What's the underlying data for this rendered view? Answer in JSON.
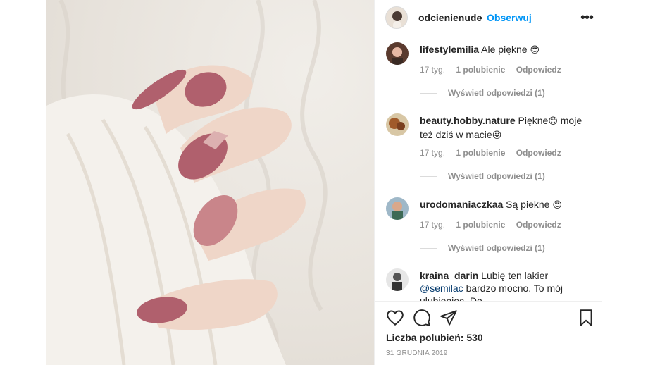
{
  "header": {
    "username": "odcienienude",
    "dot": "•",
    "follow_label": "Obserwuj"
  },
  "comments": [
    {
      "username": "lifestylemilia",
      "text": "Ale piękne",
      "emoji": "😍",
      "text2": "",
      "time": "17 tyg.",
      "likes": "1 polubienie",
      "reply": "Odpowiedz",
      "view_replies": "Wyświetl odpowiedzi (1)"
    },
    {
      "username": "beauty.hobby.nature",
      "text": "Piękne",
      "emoji": "😊",
      "text2": "moje też dziś w macie",
      "emoji2": "😛",
      "time": "17 tyg.",
      "likes": "1 polubienie",
      "reply": "Odpowiedz",
      "view_replies": "Wyświetl odpowiedzi (1)"
    },
    {
      "username": "urodomaniaczkaa",
      "text": "Są piekne",
      "emoji": "😍",
      "text2": "",
      "time": "17 tyg.",
      "likes": "1 polubienie",
      "reply": "Odpowiedz",
      "view_replies": "Wyświetl odpowiedzi (1)"
    },
    {
      "username": "kraina_darin",
      "text": "Lubię ten lakier",
      "mention": "@semilac",
      "text2": "bardzo mocno. To mój ulubieniec. Do"
    }
  ],
  "actions": {
    "likes_text": "Liczba polubień: 530",
    "date": "31 GRUDNIA 2019"
  },
  "colors": {
    "accent": "#0095f6",
    "nail": "#b0606d",
    "glitter": "#c9858a"
  }
}
